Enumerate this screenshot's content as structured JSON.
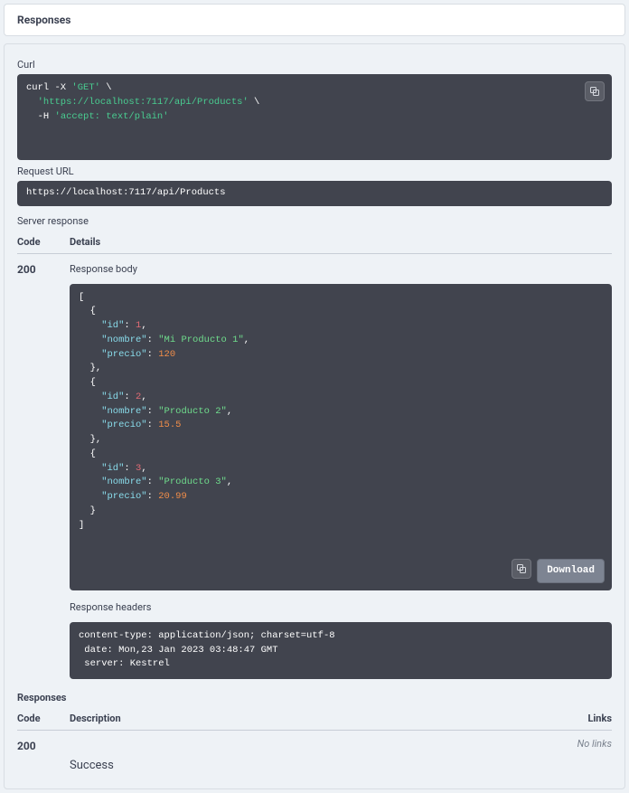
{
  "header": {
    "title": "Responses"
  },
  "curl": {
    "label": "Curl",
    "line1_a": "curl -X ",
    "line1_b": "'GET'",
    "line1_c": " \\",
    "line2": "  'https://localhost:7117/api/Products'",
    "line2_c": " \\",
    "line3_a": "  -H ",
    "line3_b": "'accept: text/plain'"
  },
  "request_url": {
    "label": "Request URL",
    "value": "https://localhost:7117/api/Products"
  },
  "server_response": {
    "label": "Server response",
    "code_header": "Code",
    "details_header": "Details",
    "code": "200",
    "body_label": "Response body",
    "headers_label": "Response headers",
    "download_label": "Download",
    "body_tokens": [
      {
        "t": "[",
        "c": "s-white"
      },
      {
        "t": "\n  {",
        "c": "s-white"
      },
      {
        "t": "\n    \"id\"",
        "c": "s-cyan"
      },
      {
        "t": ": ",
        "c": "s-white"
      },
      {
        "t": "1",
        "c": "s-red"
      },
      {
        "t": ",",
        "c": "s-white"
      },
      {
        "t": "\n    \"nombre\"",
        "c": "s-cyan"
      },
      {
        "t": ": ",
        "c": "s-white"
      },
      {
        "t": "\"Mi Producto 1\"",
        "c": "s-green"
      },
      {
        "t": ",",
        "c": "s-white"
      },
      {
        "t": "\n    \"precio\"",
        "c": "s-cyan"
      },
      {
        "t": ": ",
        "c": "s-white"
      },
      {
        "t": "120",
        "c": "s-orange"
      },
      {
        "t": "\n  },",
        "c": "s-white"
      },
      {
        "t": "\n  {",
        "c": "s-white"
      },
      {
        "t": "\n    \"id\"",
        "c": "s-cyan"
      },
      {
        "t": ": ",
        "c": "s-white"
      },
      {
        "t": "2",
        "c": "s-red"
      },
      {
        "t": ",",
        "c": "s-white"
      },
      {
        "t": "\n    \"nombre\"",
        "c": "s-cyan"
      },
      {
        "t": ": ",
        "c": "s-white"
      },
      {
        "t": "\"Producto 2\"",
        "c": "s-green"
      },
      {
        "t": ",",
        "c": "s-white"
      },
      {
        "t": "\n    \"precio\"",
        "c": "s-cyan"
      },
      {
        "t": ": ",
        "c": "s-white"
      },
      {
        "t": "15.5",
        "c": "s-orange"
      },
      {
        "t": "\n  },",
        "c": "s-white"
      },
      {
        "t": "\n  {",
        "c": "s-white"
      },
      {
        "t": "\n    \"id\"",
        "c": "s-cyan"
      },
      {
        "t": ": ",
        "c": "s-white"
      },
      {
        "t": "3",
        "c": "s-red"
      },
      {
        "t": ",",
        "c": "s-white"
      },
      {
        "t": "\n    \"nombre\"",
        "c": "s-cyan"
      },
      {
        "t": ": ",
        "c": "s-white"
      },
      {
        "t": "\"Producto 3\"",
        "c": "s-green"
      },
      {
        "t": ",",
        "c": "s-white"
      },
      {
        "t": "\n    \"precio\"",
        "c": "s-cyan"
      },
      {
        "t": ": ",
        "c": "s-white"
      },
      {
        "t": "20.99",
        "c": "s-orange"
      },
      {
        "t": "\n  }",
        "c": "s-white"
      },
      {
        "t": "\n]",
        "c": "s-white"
      }
    ],
    "headers_text": "content-type: application/json; charset=utf-8 \n date: Mon,23 Jan 2023 03:48:47 GMT \n server: Kestrel "
  },
  "responses_doc": {
    "label": "Responses",
    "code_header": "Code",
    "desc_header": "Description",
    "links_header": "Links",
    "rows": [
      {
        "code": "200",
        "description": "Success",
        "links": "No links"
      }
    ]
  }
}
